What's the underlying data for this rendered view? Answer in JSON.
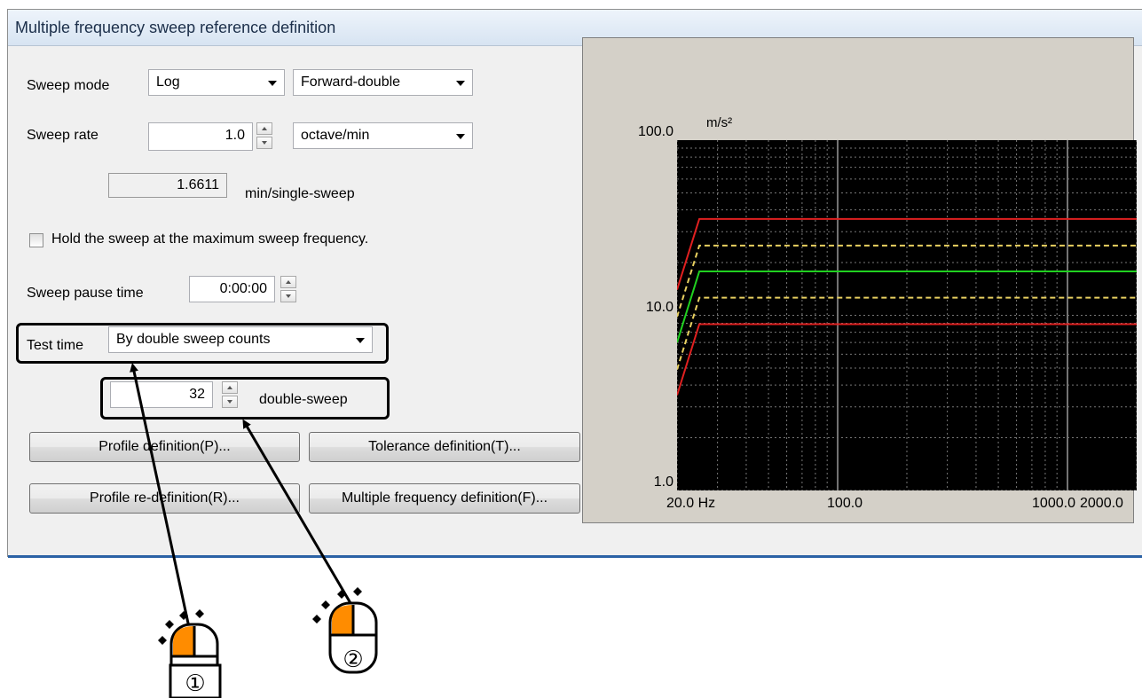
{
  "dialog": {
    "title": "Multiple frequency sweep reference definition",
    "sweep_mode": {
      "label": "Sweep mode",
      "mode_value": "Log",
      "direction_value": "Forward-double"
    },
    "sweep_rate": {
      "label": "Sweep rate",
      "value": "1.0",
      "unit_value": "octave/min"
    },
    "single_sweep": {
      "value": "1.6611",
      "unit": "min/single-sweep"
    },
    "hold_checkbox": {
      "label": "Hold the sweep at the maximum sweep frequency.",
      "checked": false
    },
    "pause": {
      "label": "Sweep pause time",
      "value": "0:00:00"
    },
    "test_time": {
      "label": "Test time",
      "value": "By double sweep counts"
    },
    "sweep_count": {
      "value": "32",
      "unit": "double-sweep"
    },
    "buttons": {
      "profile_definition": "Profile definition(P)...",
      "tolerance_definition": "Tolerance definition(T)...",
      "profile_redefinition": "Profile re-definition(R)...",
      "multiple_frequency_definition": "Multiple frequency definition(F)..."
    }
  },
  "chart_data": {
    "type": "line",
    "x_scale": "log",
    "y_scale": "log",
    "xlim": [
      20,
      2000
    ],
    "ylim": [
      1,
      100
    ],
    "unit_label": "m/s²",
    "x_tick_labels": [
      {
        "x": 20,
        "label": "20.0 Hz"
      },
      {
        "x": 100,
        "label": "100.0"
      },
      {
        "x": 1000,
        "label": "1000.0"
      },
      {
        "x": 2000,
        "label": "2000.0"
      }
    ],
    "y_tick_labels": [
      {
        "y": 100,
        "label": "100.0"
      },
      {
        "y": 10,
        "label": "10.0"
      },
      {
        "y": 1,
        "label": "1.0"
      }
    ],
    "grid": true,
    "background": "#000000",
    "series": [
      {
        "role": "upper-abort",
        "color": "#e02020",
        "dash": false,
        "points": [
          [
            20,
            14.0
          ],
          [
            25,
            35.5
          ],
          [
            2000,
            35.5
          ]
        ]
      },
      {
        "role": "upper-alarm",
        "color": "#e8d060",
        "dash": true,
        "points": [
          [
            20,
            9.8
          ],
          [
            25,
            25.0
          ],
          [
            2000,
            25.0
          ]
        ]
      },
      {
        "role": "reference",
        "color": "#20d020",
        "dash": false,
        "points": [
          [
            20,
            7.0
          ],
          [
            25,
            17.8
          ],
          [
            2000,
            17.8
          ]
        ]
      },
      {
        "role": "lower-alarm",
        "color": "#e8d060",
        "dash": true,
        "points": [
          [
            20,
            4.9
          ],
          [
            25,
            12.6
          ],
          [
            2000,
            12.6
          ]
        ]
      },
      {
        "role": "lower-abort",
        "color": "#e02020",
        "dash": false,
        "points": [
          [
            20,
            3.5
          ],
          [
            25,
            8.9
          ],
          [
            2000,
            8.9
          ]
        ]
      }
    ]
  },
  "callouts": [
    {
      "number": "①"
    },
    {
      "number": "②"
    }
  ],
  "colors": {
    "mouse_button": "#ff8c00",
    "highlight": "#000000",
    "accent": "#2b62a5"
  }
}
